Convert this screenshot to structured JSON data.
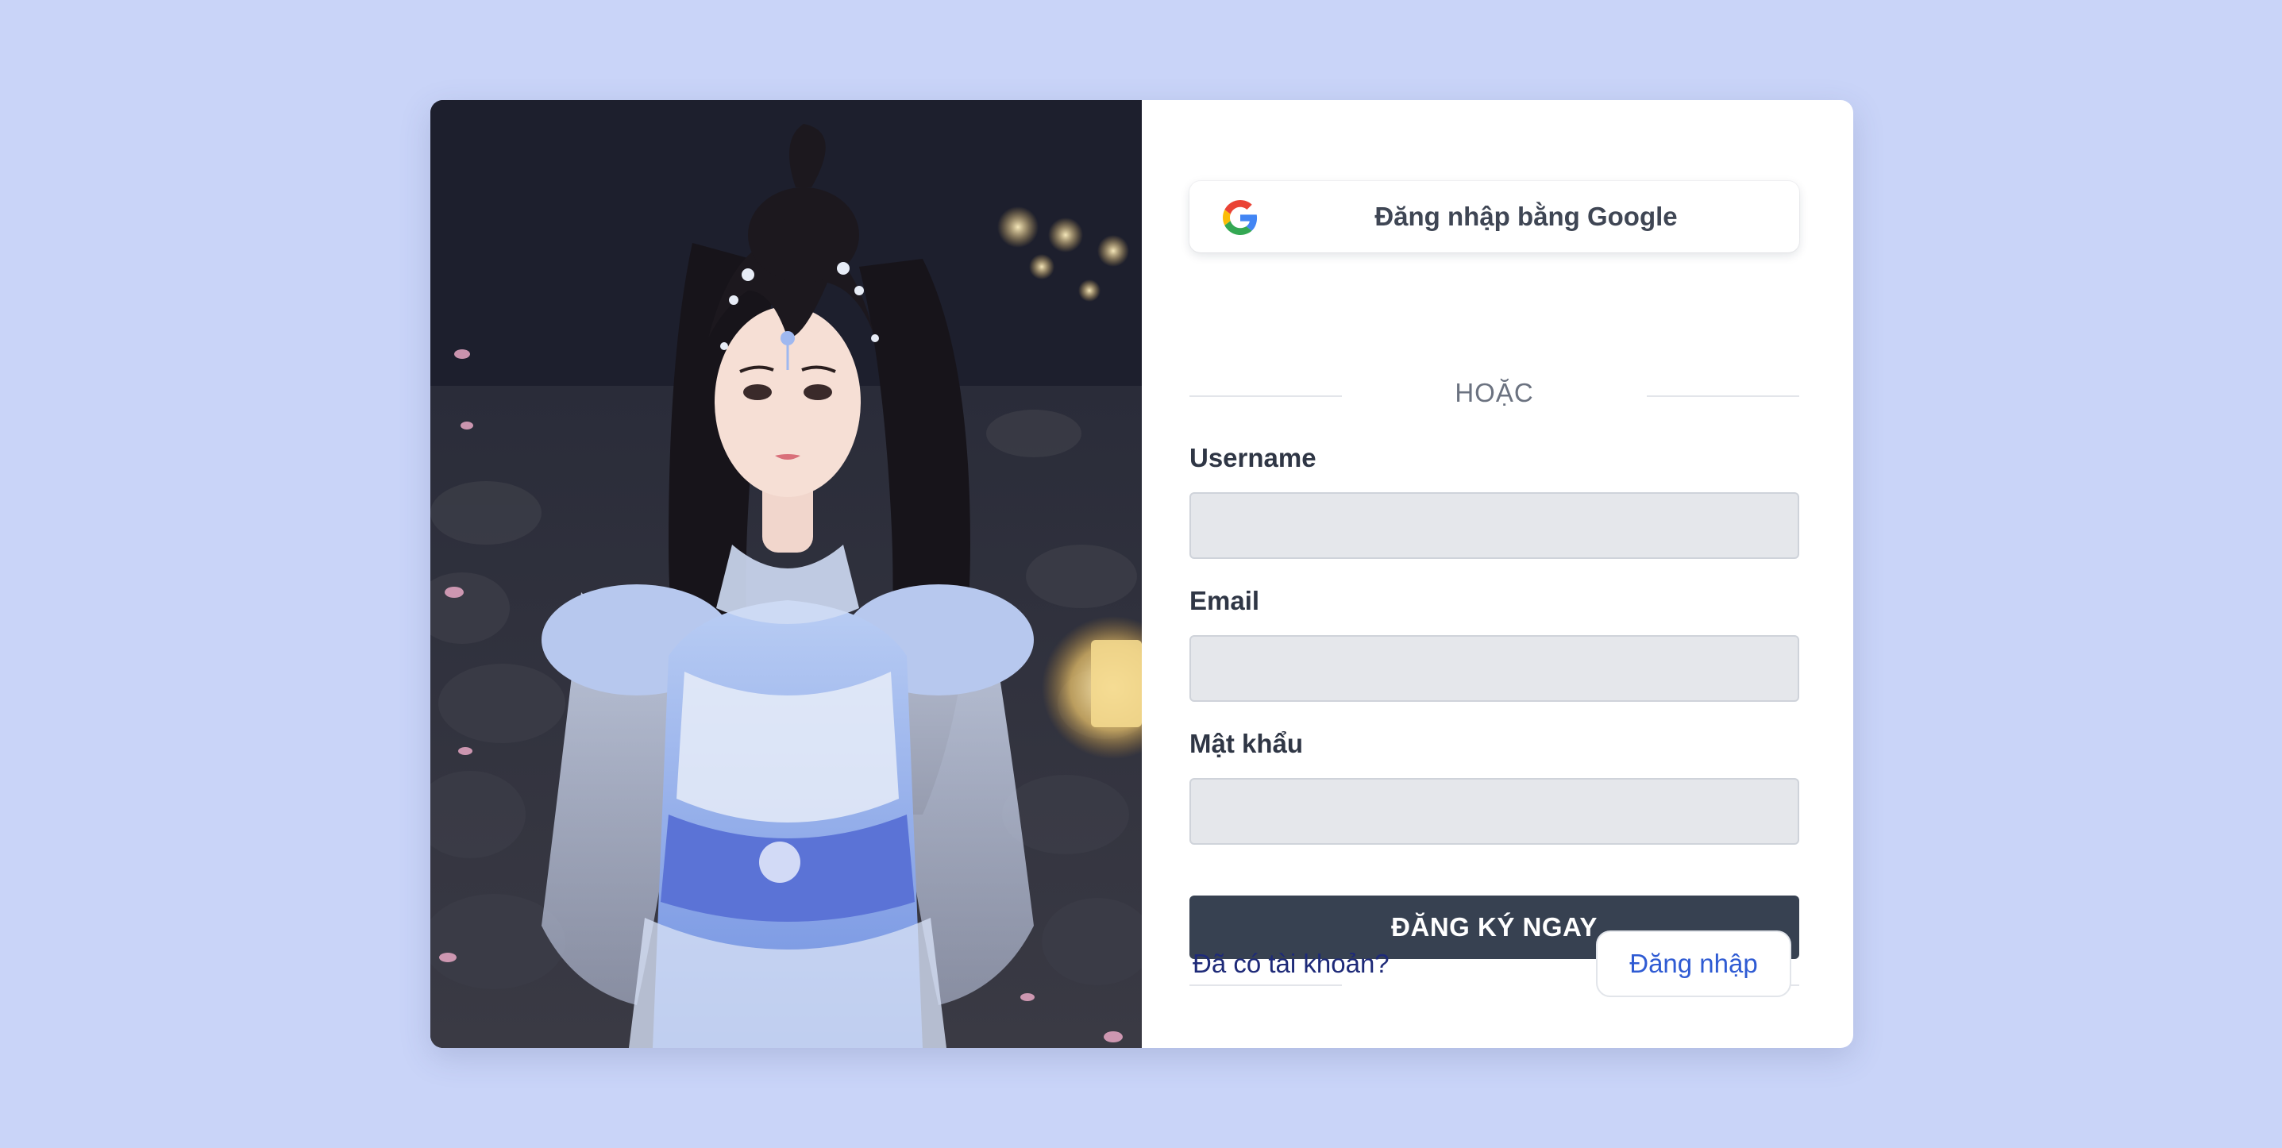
{
  "page": {
    "background_color": "#c9d4f8"
  },
  "illustration": {
    "icon": "character-portrait-illustration"
  },
  "google_signin": {
    "label": "Đăng nhập bằng Google",
    "icon": "google-icon"
  },
  "divider": {
    "text": "HOẶC"
  },
  "fields": {
    "username": {
      "label": "Username",
      "value": "",
      "placeholder": ""
    },
    "email": {
      "label": "Email",
      "value": "",
      "placeholder": ""
    },
    "password": {
      "label": "Mật khẩu",
      "value": "",
      "placeholder": ""
    }
  },
  "submit": {
    "label": "ĐĂNG KÝ NGAY",
    "color": "#374151"
  },
  "footer": {
    "question": "Đã có tài khoản?",
    "login_label": "Đăng nhập",
    "link_color": "#2f5bd3"
  }
}
